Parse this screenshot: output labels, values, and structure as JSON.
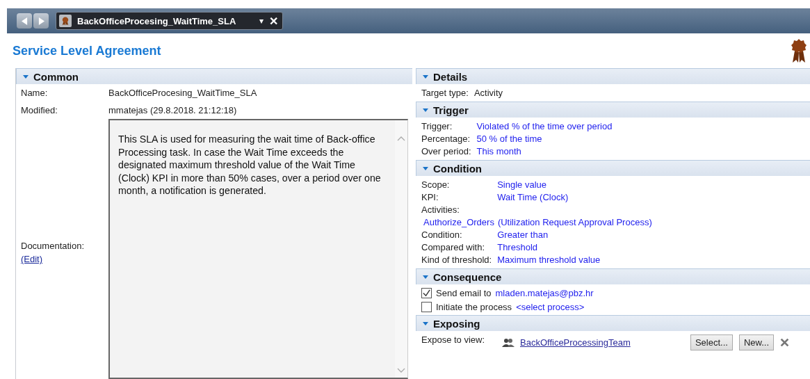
{
  "tab": {
    "title": "BackOfficeProcesing_WaitTime_SLA",
    "dropdown": "▾",
    "close": "✕"
  },
  "page_title": "Service Level Agreement",
  "common": {
    "heading": "Common",
    "expanded": true,
    "fields": [
      {
        "label": "Name:",
        "value": "BackOfficeProcesing_WaitTime_SLA"
      },
      {
        "label": "Modified:",
        "value": "mmatejas (29.8.2018. 21:12:18)"
      }
    ],
    "documentation": {
      "label": "Documentation:",
      "edit_link": "(Edit)",
      "text": "This SLA is used for measuring the wait time of Back-office Processing task. In case the Wait Time exceeds the designated maximum threshold value of the Wait Time  (Clock)  KPI  in more than 50% cases, over a period over one month, a notification is generated."
    }
  },
  "sections": [
    {
      "kind": "fields",
      "heading": "Details",
      "expanded": true,
      "fields": [
        {
          "label": "Target type:",
          "value": "Activity",
          "link": false
        }
      ]
    },
    {
      "kind": "fields",
      "heading": "Trigger",
      "expanded": true,
      "fields": [
        {
          "label": "Trigger:",
          "value": "Violated % of the time over period",
          "link": true
        },
        {
          "label": "Percentage:",
          "value": "50 % of the time",
          "link": true
        },
        {
          "label": "Over period:",
          "value": "This month",
          "link": true
        }
      ]
    },
    {
      "kind": "fields",
      "heading": "Condition",
      "expanded": true,
      "fields": [
        {
          "label": "Scope:",
          "value": "Single value",
          "link": true
        },
        {
          "label": "KPI:",
          "value": "Wait Time (Clock)",
          "link": true
        },
        {
          "label": "Activities:",
          "values": [
            "Authorize_Orders",
            "(Utilization Request Approval Process)"
          ],
          "link": true
        },
        {
          "label": "Condition:",
          "value": "Greater than",
          "link": true
        },
        {
          "label": "Compared with:",
          "value": "Threshold",
          "link": true
        },
        {
          "label": "Kind of threshold:",
          "value": "Maximum threshold value",
          "link": true
        }
      ]
    },
    {
      "kind": "checks",
      "heading": "Consequence",
      "expanded": true,
      "items": [
        {
          "label": "Send email to",
          "value": "mladen.matejas@pbz.hr",
          "checked": true
        },
        {
          "label": "Initiate the process",
          "value": "<select process>",
          "checked": false
        }
      ]
    },
    {
      "kind": "expose",
      "heading": "Exposing",
      "expanded": true,
      "label": "Expose to view:",
      "team": "BackOfficeProcessingTeam",
      "buttons": [
        "Select...",
        "New..."
      ]
    }
  ]
}
